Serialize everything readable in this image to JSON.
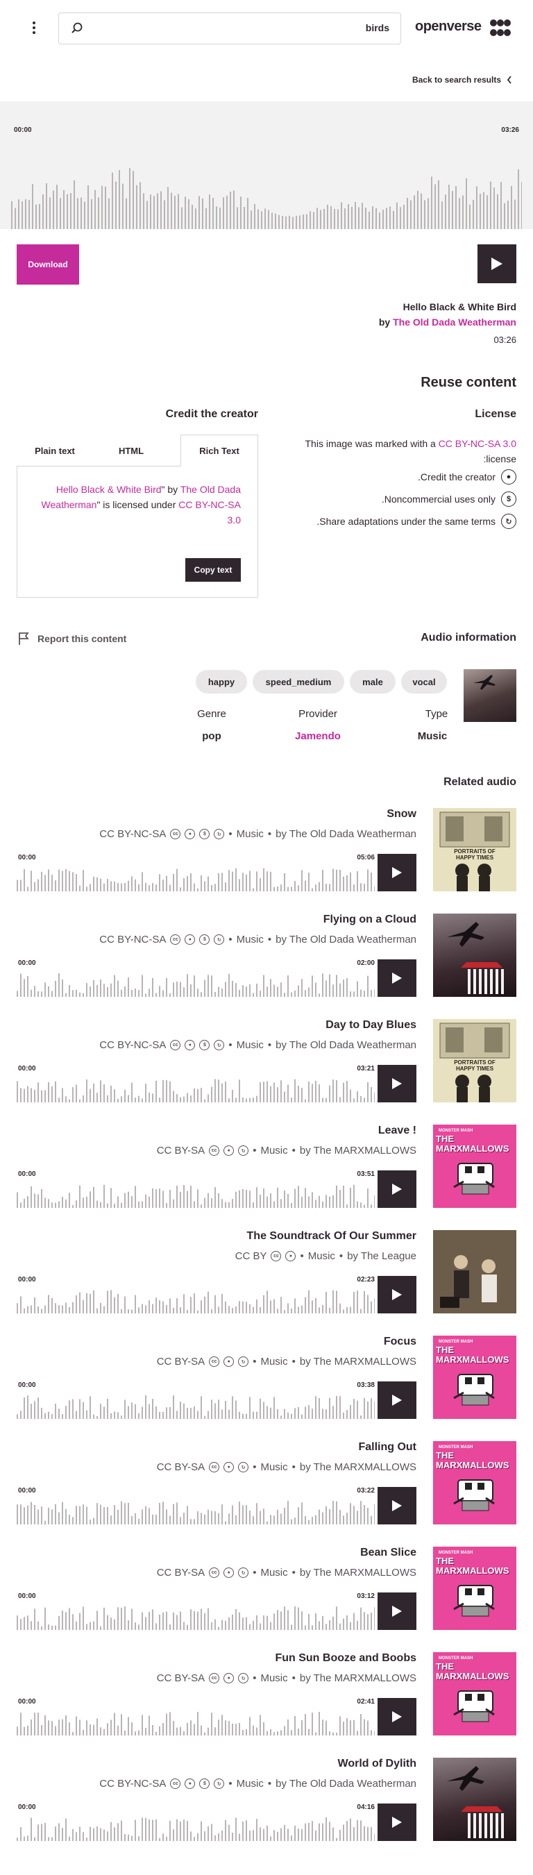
{
  "header": {
    "search_query": "birds",
    "brand": "openverse",
    "menu_icon": "kebab-menu-icon",
    "search_icon": "search-icon"
  },
  "nav": {
    "back_label": "Back to search results"
  },
  "player": {
    "current_time": "00:00",
    "duration": "03:26"
  },
  "actions": {
    "download_label": "Download"
  },
  "track": {
    "title": "Hello Black & White Bird",
    "by_prefix": "by",
    "artist": "The Old Dada Weatherman",
    "duration": "03:26"
  },
  "reuse": {
    "title": "Reuse content",
    "credit_title": "Credit the creator",
    "license_title": "License",
    "tabs": [
      "Plain text",
      "HTML",
      "Rich Text"
    ],
    "active_tab": "Rich Text",
    "credit": {
      "work_title": "Hello Black & White Bird",
      "by_text": "\" by ",
      "creator": "The Old Dada Weatherman",
      "quote_close": "\"",
      "licensed_text": " is licensed under ",
      "license_name": "CC BY-NC-SA 3.0"
    },
    "copy_label": "Copy text",
    "license_intro_pre": "This image was marked with a",
    "license_link": "CC BY-NC-SA 3.0",
    "license_intro_post": "license:",
    "license_items": [
      {
        "text": "Credit the creator.",
        "icon": "cc-by-icon"
      },
      {
        "text": "Noncommercial uses only.",
        "icon": "cc-nc-icon"
      },
      {
        "text": "Share adaptations under the same terms.",
        "icon": "cc-sa-icon"
      }
    ]
  },
  "report": {
    "label": "Report this content"
  },
  "audio_info": {
    "title": "Audio information",
    "tags": [
      "happy",
      "speed_medium",
      "male",
      "vocal"
    ],
    "labels": {
      "genre": "Genre",
      "provider": "Provider",
      "type": "Type"
    },
    "values": {
      "genre": "pop",
      "provider": "Jamendo",
      "type": "Music"
    }
  },
  "related": {
    "title": "Related audio",
    "items": [
      {
        "title": "Snow",
        "license": "CC BY-NC-SA",
        "icons": [
          "cc",
          "by",
          "nc",
          "sa"
        ],
        "category": "Music",
        "by": "by The Old Dada Weatherman",
        "start": "00:00",
        "duration": "05:06",
        "thumb": "portraits"
      },
      {
        "title": "Flying on a Cloud",
        "license": "CC BY-NC-SA",
        "icons": [
          "cc",
          "by",
          "nc",
          "sa"
        ],
        "category": "Music",
        "by": "by The Old Dada Weatherman",
        "start": "00:00",
        "duration": "02:00",
        "thumb": "plane"
      },
      {
        "title": "Day to Day Blues",
        "license": "CC BY-NC-SA",
        "icons": [
          "cc",
          "by",
          "nc",
          "sa"
        ],
        "category": "Music",
        "by": "by The Old Dada Weatherman",
        "start": "00:00",
        "duration": "03:21",
        "thumb": "portraits"
      },
      {
        "title": "Leave !",
        "license": "CC BY-SA",
        "icons": [
          "cc",
          "by",
          "sa"
        ],
        "category": "Music",
        "by": "by The MARXMALLOWS",
        "start": "00:00",
        "duration": "03:51",
        "thumb": "marx"
      },
      {
        "title": "The Soundtrack Of Our Summer",
        "license": "CC BY",
        "icons": [
          "cc",
          "by"
        ],
        "category": "Music",
        "by": "by The League",
        "start": "00:00",
        "duration": "02:23",
        "thumb": "league"
      },
      {
        "title": "Focus",
        "license": "CC BY-SA",
        "icons": [
          "cc",
          "by",
          "sa"
        ],
        "category": "Music",
        "by": "by The MARXMALLOWS",
        "start": "00:00",
        "duration": "03:38",
        "thumb": "marx"
      },
      {
        "title": "Falling Out",
        "license": "CC BY-SA",
        "icons": [
          "cc",
          "by",
          "sa"
        ],
        "category": "Music",
        "by": "by The MARXMALLOWS",
        "start": "00:00",
        "duration": "03:22",
        "thumb": "marx"
      },
      {
        "title": "Bean Slice",
        "license": "CC BY-SA",
        "icons": [
          "cc",
          "by",
          "sa"
        ],
        "category": "Music",
        "by": "by The MARXMALLOWS",
        "start": "00:00",
        "duration": "03:12",
        "thumb": "marx"
      },
      {
        "title": "Fun Sun Booze and Boobs",
        "license": "CC BY-SA",
        "icons": [
          "cc",
          "by",
          "sa"
        ],
        "category": "Music",
        "by": "by The MARXMALLOWS",
        "start": "00:00",
        "duration": "02:41",
        "thumb": "marx"
      },
      {
        "title": "World of Dylith",
        "license": "CC BY-NC-SA",
        "icons": [
          "cc",
          "by",
          "nc",
          "sa"
        ],
        "category": "Music",
        "by": "by The Old Dada Weatherman",
        "start": "00:00",
        "duration": "04:16",
        "thumb": "plane"
      }
    ]
  },
  "thumb_text": {
    "portraits": "PORTRAITS OF HAPPY TIMES",
    "marx": "THE MARXMALLOWS",
    "marx_small": "MONSTER MASH"
  },
  "colors": {
    "accent": "#c52b9b",
    "dark": "#30272e",
    "wave": "#b8b4b6",
    "marx_pink": "#e8479b"
  }
}
